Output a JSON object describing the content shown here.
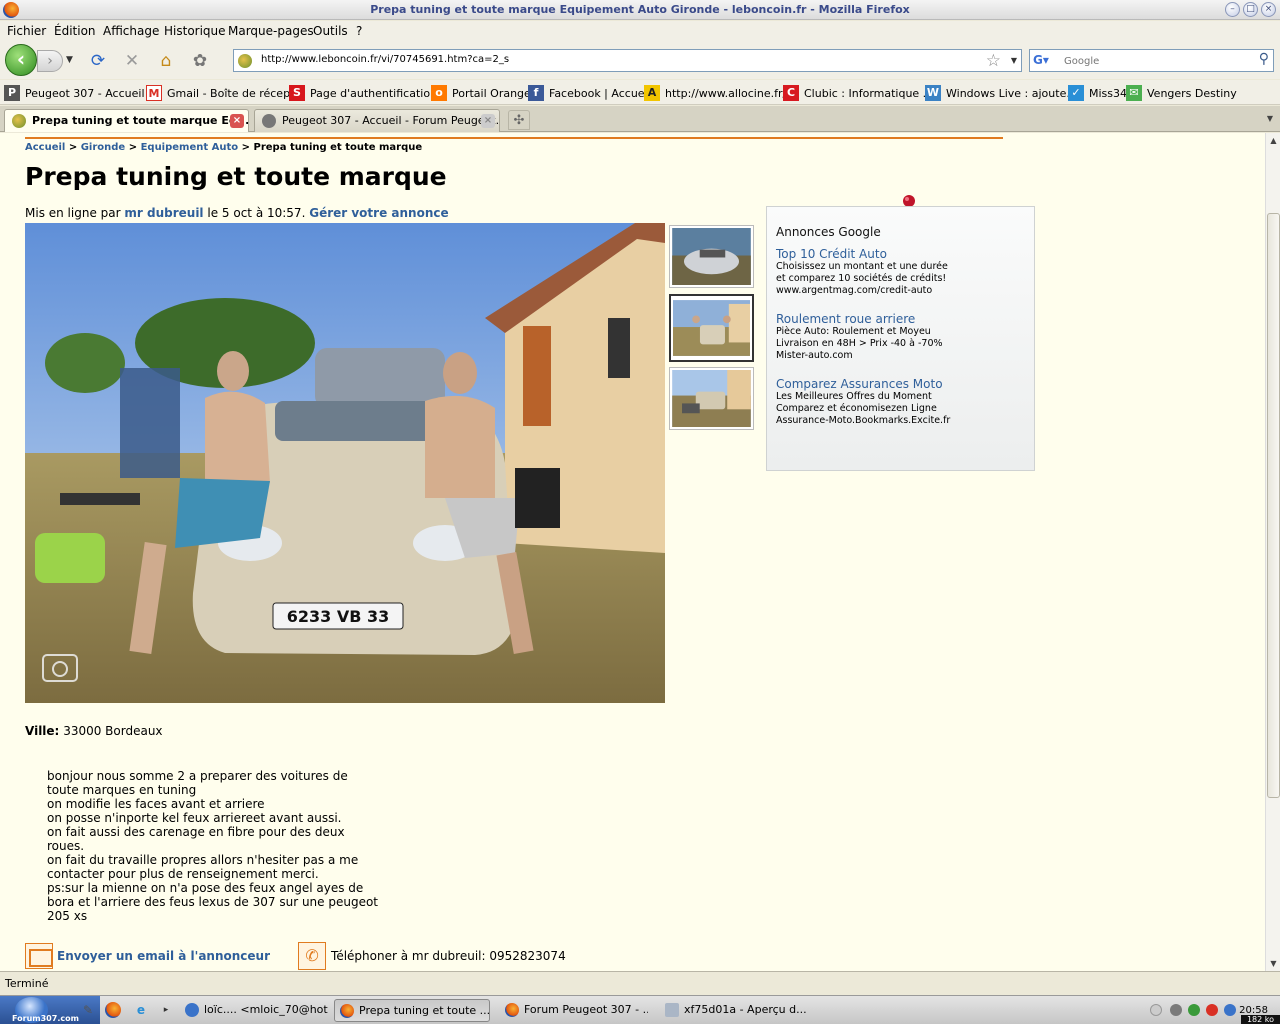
{
  "window": {
    "title": "Prepa tuning et toute marque Equipement Auto Gironde - leboncoin.fr - Mozilla Firefox"
  },
  "menu": {
    "items": [
      "Fichier",
      "Édition",
      "Affichage",
      "Historique",
      "Marque-pages",
      "Outils",
      "?"
    ]
  },
  "nav": {
    "url": "http://www.leboncoin.fr/vi/70745691.htm?ca=2_s",
    "search_placeholder": "Google"
  },
  "bookmarks": [
    {
      "label": "Peugeot 307 - Accueil ...",
      "icon": "peugeot-icon",
      "color": "#555555"
    },
    {
      "label": "Gmail - Boîte de récep...",
      "icon": "gmail-icon",
      "color": "#d93025"
    },
    {
      "label": "Page d'authentificatio...",
      "icon": "sfr-icon",
      "color": "#d7161c"
    },
    {
      "label": "Portail Orange",
      "icon": "orange-icon",
      "color": "#ff7900"
    },
    {
      "label": "Facebook | Accueil",
      "icon": "facebook-icon",
      "color": "#3b5998"
    },
    {
      "label": "http://www.allocine.fr/",
      "icon": "allocine-icon",
      "color": "#f2c500"
    },
    {
      "label": "Clubic : Informatique ...",
      "icon": "clubic-icon",
      "color": "#d71920"
    },
    {
      "label": "Windows Live : ajoute...",
      "icon": "windows-live-icon",
      "color": "#3b82c4"
    },
    {
      "label": "Miss34",
      "icon": "miss34-icon",
      "color": "#2a8fd6"
    },
    {
      "label": "Vengers Destiny",
      "icon": "vengers-icon",
      "color": "#4caf50"
    }
  ],
  "tabs": [
    {
      "label": "Prepa tuning et toute marque Eq...",
      "active": true
    },
    {
      "label": "Peugeot 307 - Accueil - Forum Peugeot...",
      "active": false
    }
  ],
  "page": {
    "breadcrumb": {
      "accueil": "Accueil",
      "gironde": "Gironde",
      "equipement": "Equipement Auto",
      "current": "Prepa tuning et toute marque",
      "sep": ">"
    },
    "title": "Prepa tuning et toute marque",
    "meta": {
      "prefix": "Mis en ligne par",
      "author": "mr dubreuil",
      "date": "le 5 oct à 10:57.",
      "manage": "Gérer votre annonce"
    },
    "photo": {
      "plate": "6233 VB 33"
    },
    "ads": {
      "heading": "Annonces Google",
      "items": [
        {
          "title": "Top 10 Crédit Auto",
          "line1": "Choisissez un montant et une durée",
          "line2": "et comparez 10 sociétés de crédits!",
          "url": "www.argentmag.com/credit-auto"
        },
        {
          "title": "Roulement roue arriere",
          "line1": "Pièce Auto: Roulement et Moyeu",
          "line2": "Livraison en 48H > Prix -40 à -70%",
          "url": "Mister-auto.com"
        },
        {
          "title": "Comparez Assurances Moto",
          "line1": "Les Meilleures Offres du Moment",
          "line2": "Comparez et économisezen Ligne",
          "url": "Assurance-Moto.Bookmarks.Excite.fr"
        }
      ]
    },
    "ville": {
      "label": "Ville:",
      "value": "33000 Bordeaux"
    },
    "description": [
      "bonjour nous somme 2 a preparer des voitures de",
      "toute marques en tuning",
      "on modifie les faces avant et arriere",
      "on posse n'inporte kel feux arriereet avant aussi.",
      "on fait aussi des carenage en fibre pour des deux",
      "roues.",
      "on fait du travaille propres allors n'hesiter pas a me",
      "contacter pour plus de renseignement merci.",
      "ps:sur la mienne on n'a pose des feux angel ayes de",
      "bora et l'arriere des feus lexus de 307 sur une peugeot",
      "205 xs"
    ],
    "contact": {
      "email": "Envoyer un email à l'annonceur",
      "phone": "Téléphoner à mr dubreuil: 0952823074"
    }
  },
  "status": {
    "text": "Terminé"
  },
  "taskbar": {
    "start_label": "Forum307.com",
    "tasks": [
      {
        "label": "loïc.... <mloic_70@hot...",
        "active": false
      },
      {
        "label": "Prepa tuning et toute ...",
        "active": true
      },
      {
        "label": "Forum Peugeot 307 - ...",
        "active": false
      },
      {
        "label": "xf75d01a - Aperçu d...",
        "active": false
      }
    ],
    "clock": "20:58",
    "netspeed": "182 ko"
  },
  "colors": {
    "link": "#2f5f9a",
    "accent_orange": "#e07b20",
    "page_bg": "#fffeed"
  }
}
